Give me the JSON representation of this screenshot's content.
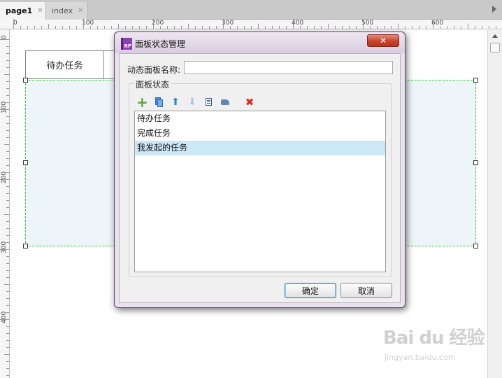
{
  "tabs": [
    {
      "label": "page1",
      "active": true
    },
    {
      "label": "index",
      "active": false
    }
  ],
  "close_glyph": "✕",
  "ruler": {
    "top_labels": [
      "0",
      "100",
      "200",
      "300",
      "400",
      "500",
      "600"
    ],
    "left_labels": [
      "0",
      "100",
      "200",
      "300",
      "400"
    ]
  },
  "canvas": {
    "tab_buttons": [
      "待办任务"
    ]
  },
  "dialog": {
    "icon_text": "RP",
    "title": "面板状态管理",
    "close_label": "✕",
    "name_label": "动态面板名称:",
    "name_value": "",
    "group_label": "面板状态",
    "toolbar_icons": [
      "add-icon",
      "duplicate-icon",
      "move-up-icon",
      "move-down-icon",
      "edit-icon",
      "move-to-icon",
      "delete-icon"
    ],
    "states": [
      {
        "label": "待办任务",
        "selected": false
      },
      {
        "label": "完成任务",
        "selected": false
      },
      {
        "label": "我发起的任务",
        "selected": true
      }
    ],
    "ok_label": "确定",
    "cancel_label": "取消"
  },
  "watermark": {
    "logo": "Bai du 经验",
    "url": "jingyan.baidu.com"
  },
  "colors": {
    "panel_fill": "#eef5f8",
    "panel_border": "#2fd02f",
    "selected_row": "#cce8f6",
    "close_button": "#c8432c"
  }
}
